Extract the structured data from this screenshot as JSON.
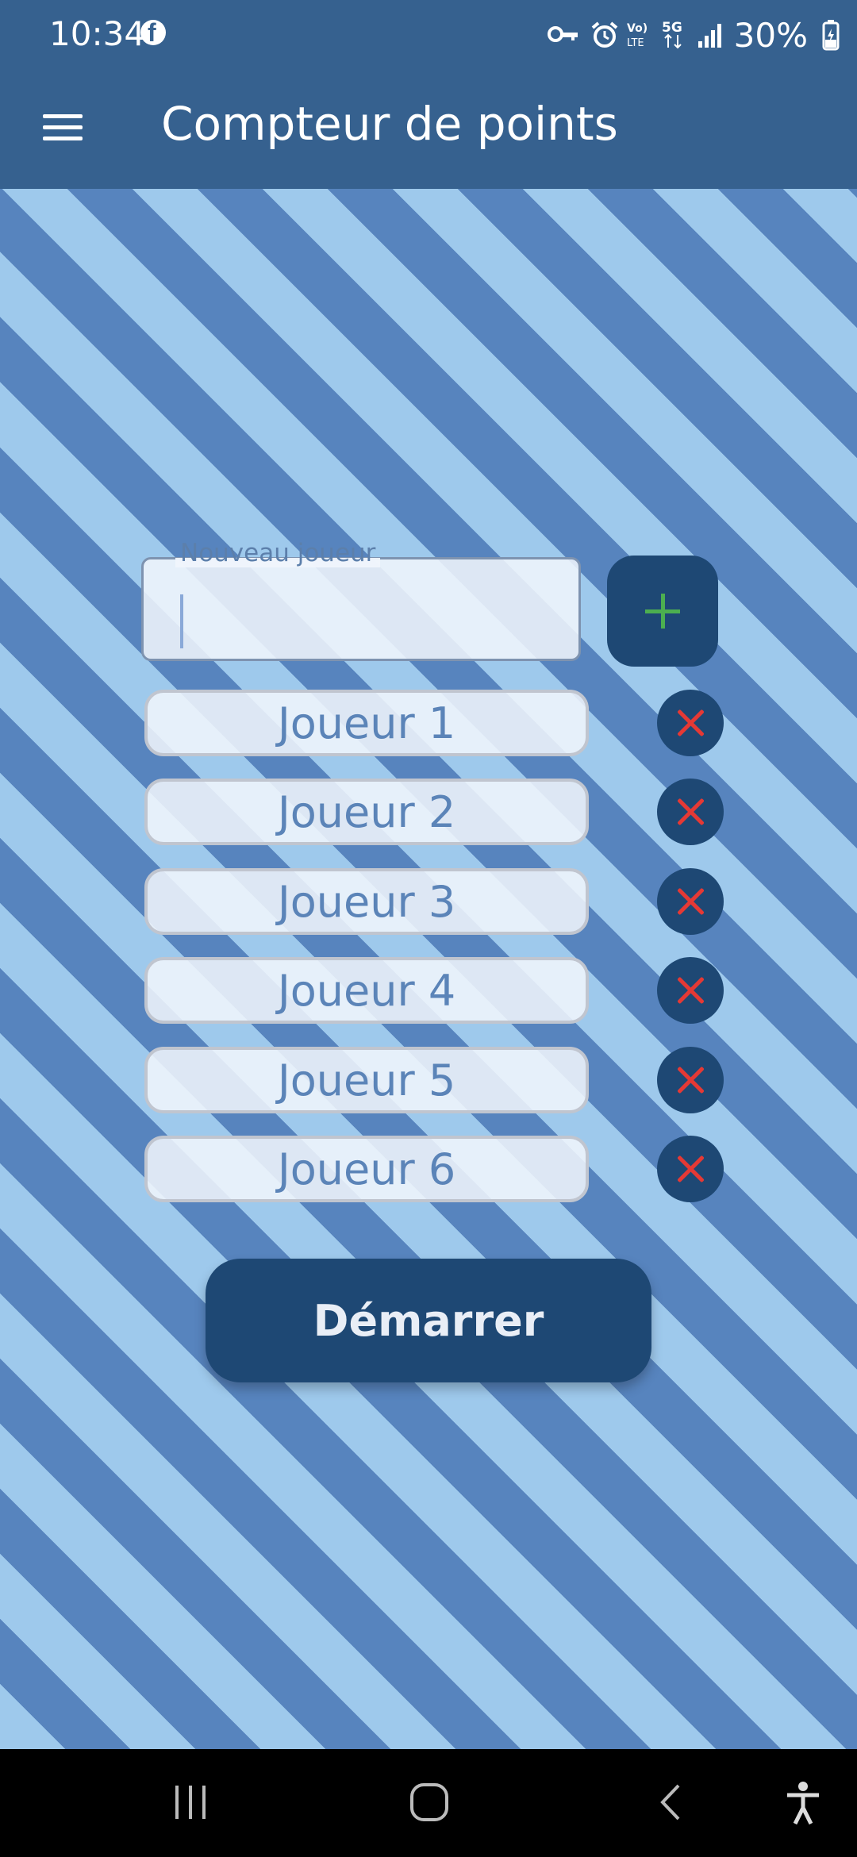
{
  "status_bar": {
    "time": "10:34",
    "battery": "30%",
    "icons": [
      "facebook-icon",
      "vpn-key-icon",
      "alarm-icon",
      "volte-icon",
      "5g-icon",
      "signal-icon",
      "battery-icon"
    ]
  },
  "app_bar": {
    "title": "Compteur de points",
    "menu_icon": "menu-icon"
  },
  "new_player": {
    "label": "Nouveau joueur",
    "value": ""
  },
  "players": [
    {
      "name": "Joueur 1"
    },
    {
      "name": "Joueur 2"
    },
    {
      "name": "Joueur 3"
    },
    {
      "name": "Joueur 4"
    },
    {
      "name": "Joueur 5"
    },
    {
      "name": "Joueur 6"
    }
  ],
  "start_button": {
    "label": "Démarrer"
  },
  "colors": {
    "app_bar": "#36618f",
    "stripe_light": "#9ec9ec",
    "stripe_dark": "#5784be",
    "button": "#1e4874",
    "add_icon": "#4caf50",
    "remove_icon": "#e53935"
  },
  "nav_bar": {
    "icons": [
      "recents-icon",
      "home-icon",
      "back-icon",
      "accessibility-icon"
    ]
  }
}
